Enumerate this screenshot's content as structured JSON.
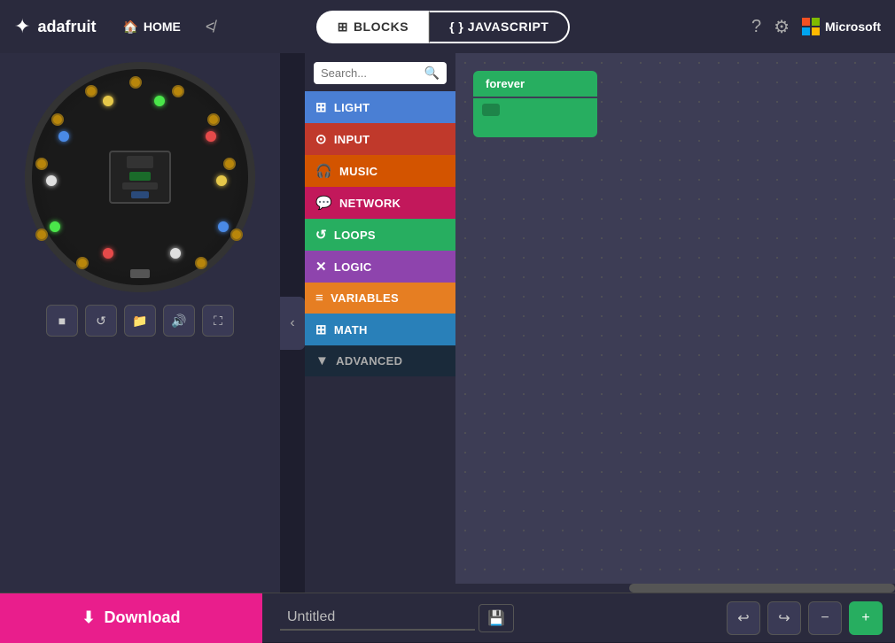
{
  "header": {
    "logo_text": "adafruit",
    "home_label": "HOME",
    "tab_blocks": "BLOCKS",
    "tab_javascript": "{ } JAVASCRIPT",
    "ms_label": "Microsoft"
  },
  "toolbox": {
    "search_placeholder": "Search...",
    "buttons": [
      {
        "id": "light",
        "label": "LIGHT",
        "icon": "⊞"
      },
      {
        "id": "input",
        "label": "INPUT",
        "icon": "⊙"
      },
      {
        "id": "music",
        "label": "MUSIC",
        "icon": "⊕"
      },
      {
        "id": "network",
        "label": "NETWORK",
        "icon": "💬"
      },
      {
        "id": "loops",
        "label": "LOOPS",
        "icon": "↺"
      },
      {
        "id": "logic",
        "label": "LOGIC",
        "icon": "✕"
      },
      {
        "id": "variables",
        "label": "VARIABLES",
        "icon": "≡"
      },
      {
        "id": "math",
        "label": "MATH",
        "icon": "⊞"
      },
      {
        "id": "advanced",
        "label": "ADVANCED",
        "icon": "▼"
      }
    ]
  },
  "workspace": {
    "forever_block_label": "forever"
  },
  "footer": {
    "download_label": "Download",
    "project_name": "Untitled"
  }
}
